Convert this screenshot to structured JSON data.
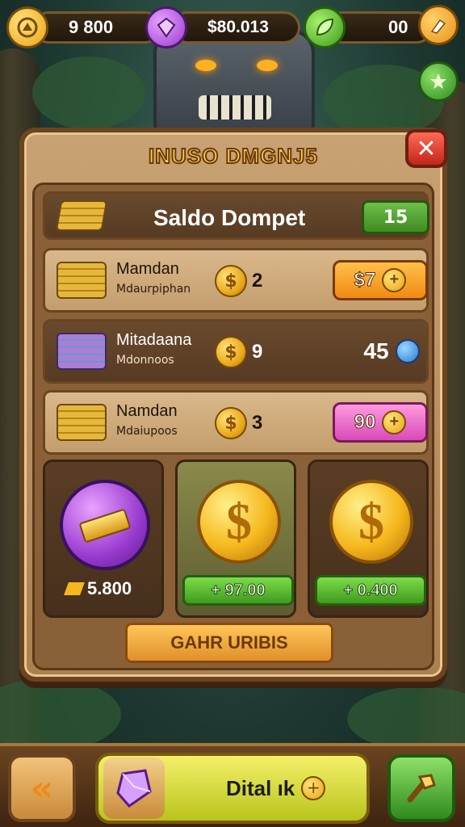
{
  "hud": {
    "gold_amount": "9 800",
    "gem_amount": "$80.013",
    "leaf_amount": "00",
    "gold_icon": "coin-icon",
    "gem_icon": "purple-gem-icon",
    "leaf_icon": "leaf-icon"
  },
  "panel": {
    "title": "INUSO DMGNJ5",
    "close_label": "✕",
    "balance": {
      "label": "Saldo Dompet",
      "value": "15"
    },
    "items": [
      {
        "name": "Mamdan",
        "sub": "Mdaurpiphan",
        "qty": "2",
        "price": "$7",
        "style": "orange"
      },
      {
        "name": "Mitadaana",
        "sub": "Mdonnoos",
        "qty": "9",
        "price": "45",
        "style": "plain"
      },
      {
        "name": "Namdan",
        "sub": "Mdaiupoos",
        "qty": "3",
        "price": "90",
        "style": "pink"
      }
    ],
    "cards": [
      {
        "amount": "5.800"
      },
      {
        "amount": "+ 97.00"
      },
      {
        "amount": "+ 0.400"
      }
    ],
    "footer_label": "GAHR URIBIS"
  },
  "bottom": {
    "back_label": "«",
    "action_label": "Dital ık",
    "right_icon": "hammer-icon"
  },
  "colors": {
    "accent_gold": "#ffd23f",
    "panel_brown": "#a9814f",
    "button_green": "#3f9a1e",
    "button_orange": "#f09a20",
    "button_pink": "#e06ad0"
  }
}
